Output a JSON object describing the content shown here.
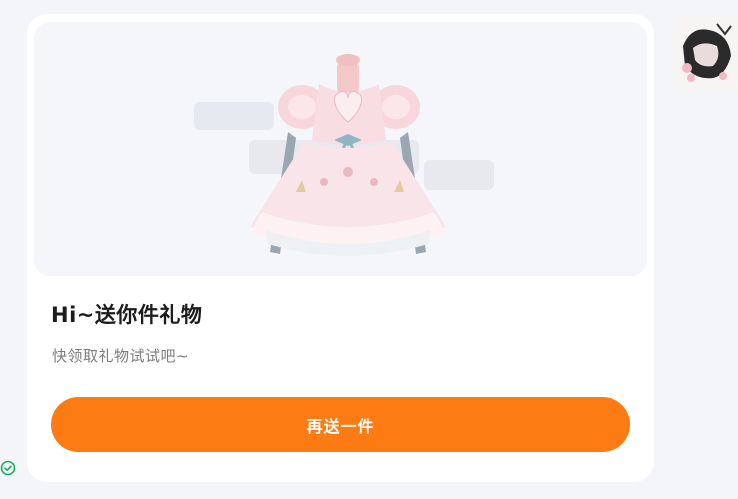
{
  "card": {
    "title": "Hi~送你件礼物",
    "subtitle": "快领取礼物试试吧~",
    "button_label": "再送一件"
  },
  "icons": {
    "gift_image": "dress-image",
    "avatar": "user-avatar",
    "status": "check-circle-icon"
  },
  "colors": {
    "accent": "#fd7b13",
    "check": "#1aad5b"
  }
}
